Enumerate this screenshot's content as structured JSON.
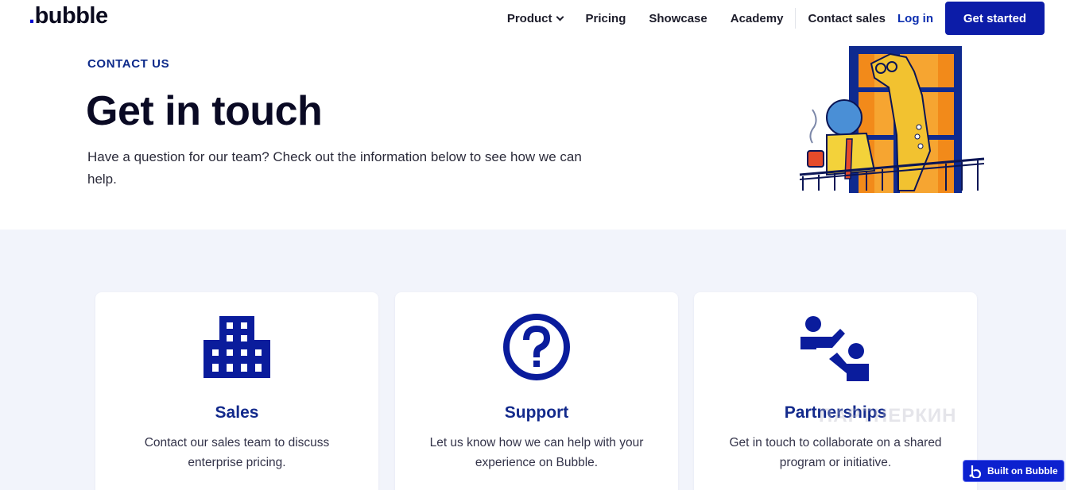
{
  "nav": {
    "logo": "bubble",
    "items": [
      {
        "label": "Product",
        "dropdown": true
      },
      {
        "label": "Pricing"
      },
      {
        "label": "Showcase"
      },
      {
        "label": "Academy"
      }
    ],
    "contact": "Contact sales",
    "login": "Log in",
    "cta": "Get started"
  },
  "hero": {
    "eyebrow": "CONTACT US",
    "title": "Get in touch",
    "description": "Have a question for our team? Check out the information below to see how we can help."
  },
  "cards": [
    {
      "icon": "building-icon",
      "title": "Sales",
      "description": "Contact our sales team to discuss enterprise pricing."
    },
    {
      "icon": "question-circle-icon",
      "title": "Support",
      "description": "Let us know how we can help with your experience on Bubble."
    },
    {
      "icon": "partners-icon",
      "title": "Partnerships",
      "description": "Get in touch to collaborate on a shared program or initiative."
    }
  ],
  "badge": "Built on Bubble",
  "watermark": "ПАРТНЕРКИН",
  "colors": {
    "brand": "#0c1ca8",
    "accent_text": "#132a8c",
    "section_bg": "#f2f4fb",
    "icon": "#0a1c9c"
  }
}
